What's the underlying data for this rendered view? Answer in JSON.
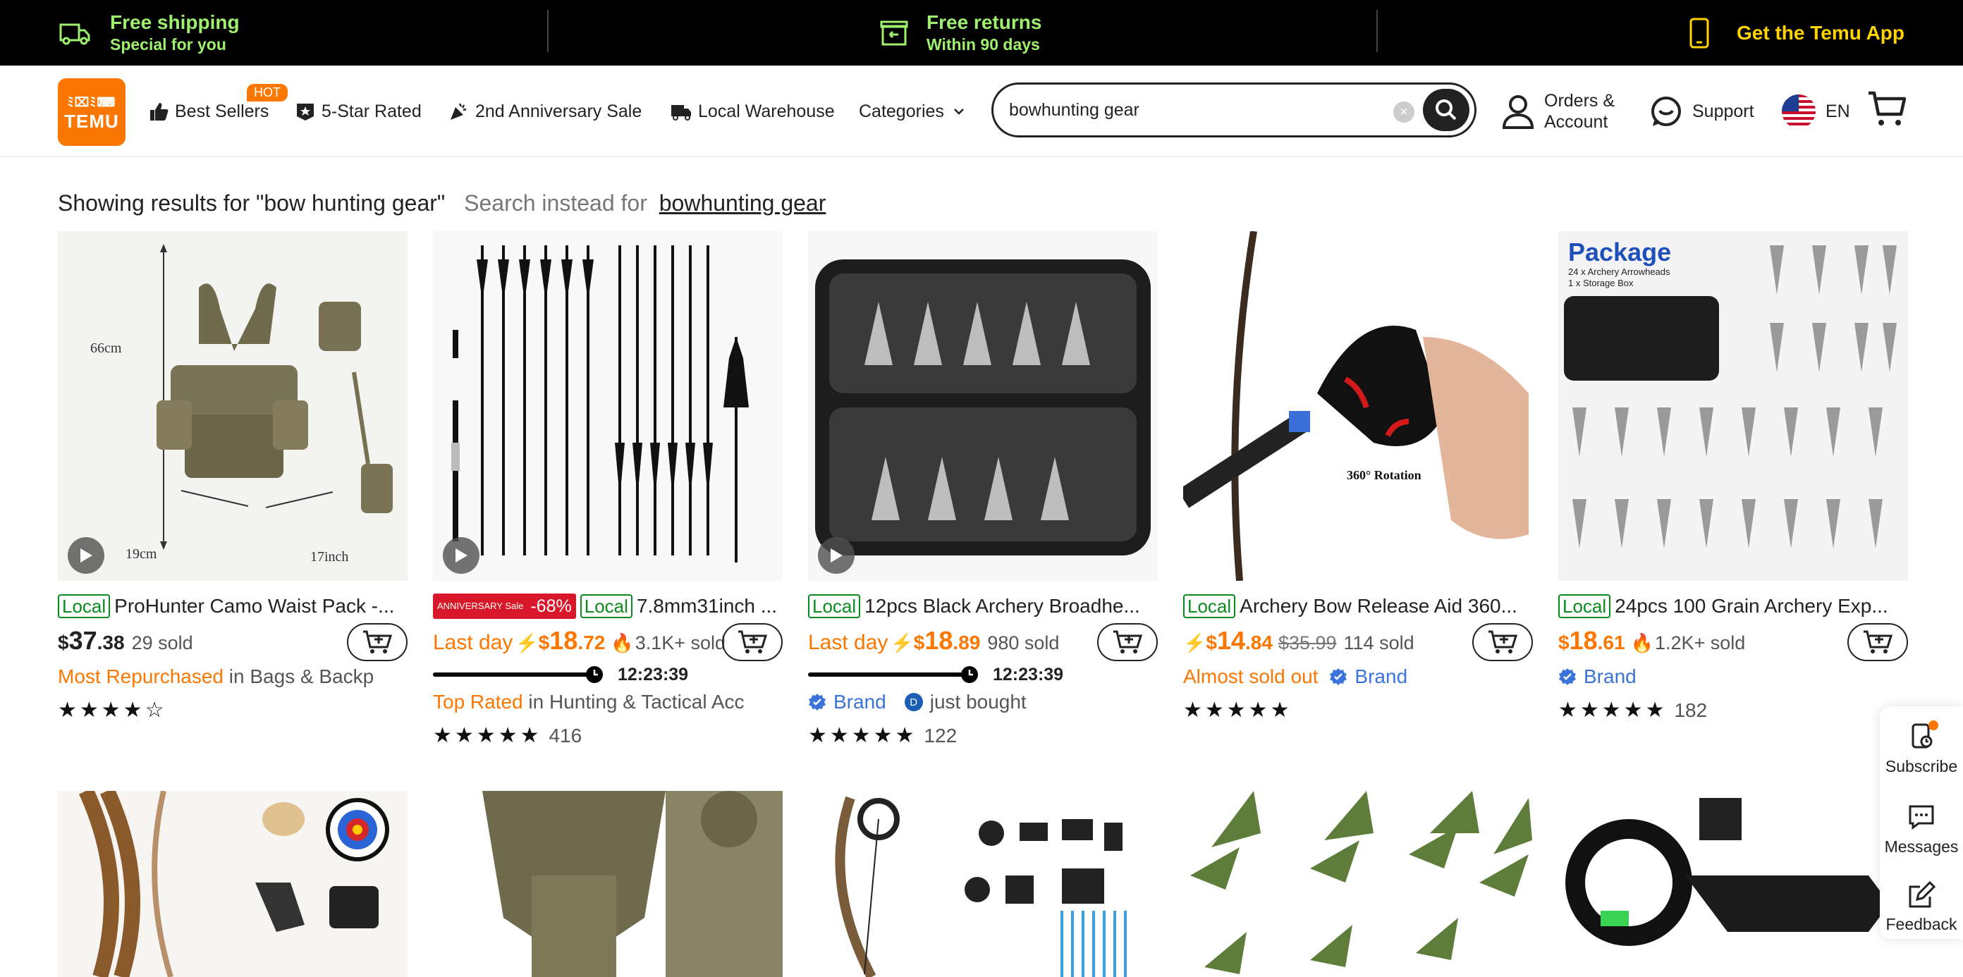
{
  "promo": {
    "shipping_title": "Free shipping",
    "shipping_sub": "Special for you",
    "returns_title": "Free returns",
    "returns_sub": "Within 90 days",
    "app": "Get the Temu App"
  },
  "header": {
    "logo_top": "ﾐ⌧ﾐ⌨",
    "logo_bottom": "TEMU",
    "nav": {
      "best_sellers": "Best Sellers",
      "hot": "HOT",
      "five_star": "5-Star Rated",
      "anniversary": "2nd Anniversary Sale",
      "warehouse": "Local Warehouse",
      "categories": "Categories"
    },
    "search_value": "bowhunting gear",
    "orders_line1": "Orders &",
    "orders_line2": "Account",
    "support": "Support",
    "lang": "EN"
  },
  "results": {
    "showing": "Showing results for \"bow hunting gear\"",
    "instead": "Search instead for",
    "instead_link": "bowhunting gear"
  },
  "products": [
    {
      "badge": "Local",
      "title": "ProHunter Camo Waist Pack -...",
      "price_symbol": "$",
      "price_int": "37",
      "price_dec": ".38",
      "sold": "29 sold",
      "tag_highlight": "Most Repurchased",
      "tag_rest": " in Bags & Backp",
      "rating": "★★★★☆",
      "reviews": ""
    },
    {
      "anniv_small": "ANNIVERSARY Sale",
      "anniv_pct": "-68%",
      "badge": "Local",
      "title": "7.8mm31inch ...",
      "lastday": "Last day",
      "price_symbol": "$",
      "price_int": "18",
      "price_dec": ".72",
      "sold": "3.1K+ sold",
      "timer": "12:23:39",
      "tag_highlight": "Top Rated",
      "tag_rest": " in Hunting & Tactical Acc",
      "rating": "★★★★★",
      "reviews": "416"
    },
    {
      "badge": "Local",
      "title": "12pcs Black Archery Broadhe...",
      "lastday": "Last day",
      "price_symbol": "$",
      "price_int": "18",
      "price_dec": ".89",
      "sold": "980 sold",
      "timer": "12:23:39",
      "brand": "Brand",
      "just_bought": "just bought",
      "avatar_letter": "D",
      "rating": "★★★★★",
      "reviews": "122"
    },
    {
      "badge": "Local",
      "title": "Archery Bow Release Aid 360...",
      "price_symbol": "$",
      "price_int": "14",
      "price_dec": ".84",
      "strike": "$35.99",
      "sold": "114 sold",
      "almost": "Almost sold out",
      "brand": "Brand",
      "rating": "★★★★★",
      "reviews": ""
    },
    {
      "badge": "Local",
      "title": "24pcs 100 Grain Archery Exp...",
      "price_symbol": "$",
      "price_int": "18",
      "price_dec": ".61",
      "sold": "1.2K+ sold",
      "brand": "Brand",
      "rating": "★★★★★",
      "reviews": "182"
    }
  ],
  "thumb_text": {
    "p1_height": "66cm",
    "p1_width": "19cm",
    "p1_depth": "17inch",
    "p4_rotation": "360° Rotation",
    "p5_title": "Package",
    "p5_line1": "24 x Archery Arrowheads",
    "p5_line2": "1 x Storage Box"
  },
  "side": {
    "subscribe": "Subscribe",
    "messages": "Messages",
    "feedback": "Feedback"
  },
  "colors": {
    "brand_orange": "#fb7701",
    "promo_green": "#9ff06e",
    "promo_yellow": "#ffd400",
    "local_green": "#0a8a1f",
    "brand_blue": "#3a73d9"
  }
}
